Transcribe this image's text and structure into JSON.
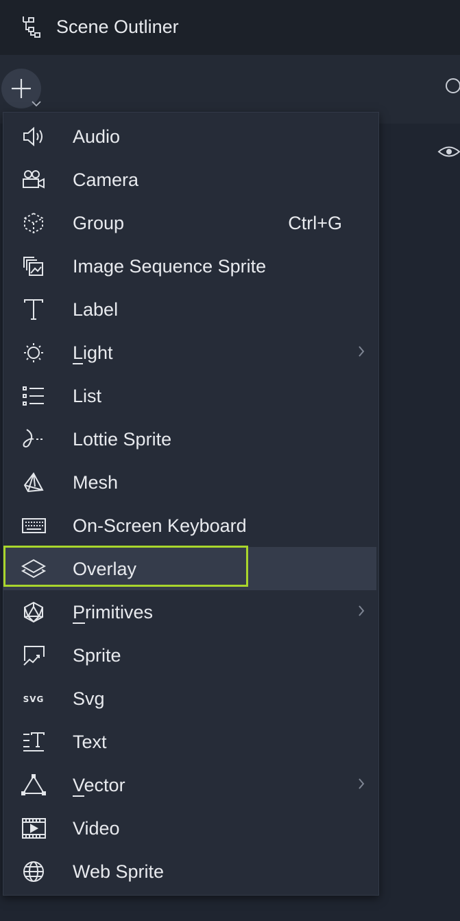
{
  "window": {
    "title": "Scene Outliner"
  },
  "toolbar": {
    "add_icon": "plus-icon"
  },
  "menu": {
    "items": [
      {
        "label": "Audio",
        "icon": "speaker-icon",
        "shortcut": "",
        "submenu": false
      },
      {
        "label": "Camera",
        "icon": "camera-icon",
        "shortcut": "",
        "submenu": false
      },
      {
        "label": "Group",
        "icon": "group-icon",
        "shortcut": "Ctrl+G",
        "submenu": false
      },
      {
        "label": "Image Sequence Sprite",
        "icon": "image-sequence-icon",
        "shortcut": "",
        "submenu": false
      },
      {
        "label": "Label",
        "icon": "label-icon",
        "shortcut": "",
        "submenu": false
      },
      {
        "label": "Light",
        "icon": "light-icon",
        "shortcut": "",
        "submenu": true,
        "mnemonic": "L"
      },
      {
        "label": "List",
        "icon": "list-icon",
        "shortcut": "",
        "submenu": false
      },
      {
        "label": "Lottie Sprite",
        "icon": "lottie-icon",
        "shortcut": "",
        "submenu": false
      },
      {
        "label": "Mesh",
        "icon": "mesh-icon",
        "shortcut": "",
        "submenu": false
      },
      {
        "label": "On-Screen Keyboard",
        "icon": "keyboard-icon",
        "shortcut": "",
        "submenu": false
      },
      {
        "label": "Overlay",
        "icon": "overlay-icon",
        "shortcut": "",
        "submenu": false,
        "selected": true
      },
      {
        "label": "Primitives",
        "icon": "primitives-icon",
        "shortcut": "",
        "submenu": true,
        "mnemonic": "P"
      },
      {
        "label": "Sprite",
        "icon": "sprite-icon",
        "shortcut": "",
        "submenu": false
      },
      {
        "label": "Svg",
        "icon": "svg-icon",
        "shortcut": "",
        "submenu": false
      },
      {
        "label": "Text",
        "icon": "text-icon",
        "shortcut": "",
        "submenu": false
      },
      {
        "label": "Vector",
        "icon": "vector-icon",
        "shortcut": "",
        "submenu": true,
        "mnemonic": "V"
      },
      {
        "label": "Video",
        "icon": "video-icon",
        "shortcut": "",
        "submenu": false
      },
      {
        "label": "Web Sprite",
        "icon": "web-sprite-icon",
        "shortcut": "",
        "submenu": false
      }
    ],
    "svg_icon_text": "SVG"
  },
  "colors": {
    "highlight_border": "#a9d62c",
    "menu_background": "#262c38",
    "selected_background": "#353c4b"
  }
}
